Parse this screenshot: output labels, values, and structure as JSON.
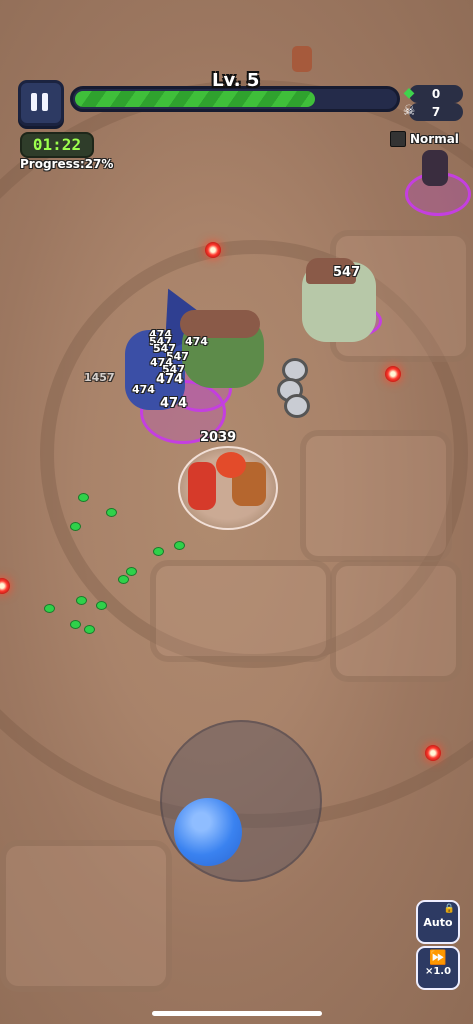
{
  "hud": {
    "level_label": "Lv. 5",
    "xp_fraction": 0.74,
    "gem_count": "0",
    "kill_count": "7",
    "timer": "01:22",
    "progress": "Progress:27%",
    "mode_label": "Normal"
  },
  "icons": {
    "pause": "pause-icon",
    "gem": "green-gem-icon",
    "kill": "skull-icon",
    "lock": "lock-icon",
    "fast_forward": "fast-forward-icon"
  },
  "damage_numbers": [
    "474",
    "547",
    "547",
    "474",
    "547",
    "474",
    "547",
    "474",
    "474",
    "474",
    "547",
    "1457",
    "2039"
  ],
  "controls": {
    "auto_label": "Auto",
    "speed_label": "×1.0"
  },
  "colors": {
    "xp_fill": "#3fbf3a",
    "timer_text": "#9cff4d",
    "hud_panel": "#2d3a63",
    "enemy_ring": "#c43fe0",
    "joystick": "#3a82f0"
  }
}
